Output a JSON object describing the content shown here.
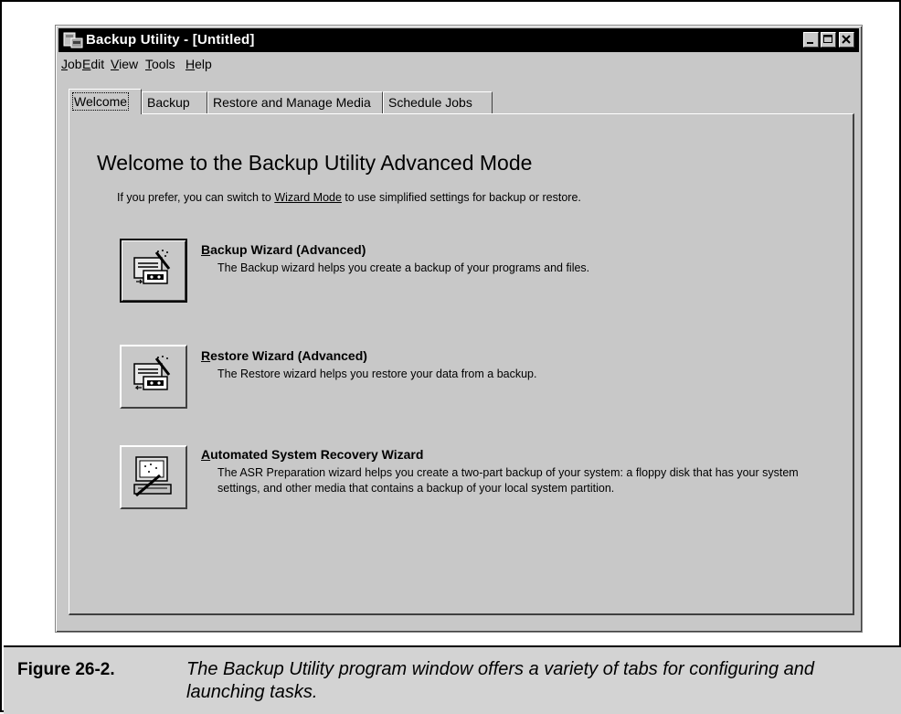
{
  "window": {
    "title": "Backup Utility - [Untitled]",
    "minimize_label": "▁",
    "maximize_label": "□",
    "close_label": "✕"
  },
  "menu": [
    {
      "hotkey": "J",
      "rest": "ob"
    },
    {
      "hotkey": "E",
      "rest": "dit"
    },
    {
      "hotkey": "V",
      "rest": "iew"
    },
    {
      "hotkey": "T",
      "rest": "ools"
    },
    {
      "hotkey": "H",
      "rest": "elp"
    }
  ],
  "tabs": [
    {
      "label": "Welcome",
      "active": true
    },
    {
      "label": "Backup",
      "active": false
    },
    {
      "label": "Restore and Manage Media",
      "active": false
    },
    {
      "label": "Schedule Jobs",
      "active": false
    }
  ],
  "welcome": {
    "heading": "Welcome to the Backup Utility Advanced Mode",
    "intro_before": "If you prefer, you can switch to ",
    "intro_link": "Wizard Mode",
    "intro_after": " to use simplified settings for backup or restore."
  },
  "wizards": [
    {
      "icon": "backup-wizard-icon",
      "hotkey": "B",
      "title_rest": "ackup Wizard (Advanced)",
      "description": "The Backup wizard helps you create a backup of your programs and files."
    },
    {
      "icon": "restore-wizard-icon",
      "hotkey": "R",
      "title_rest": "estore Wizard (Advanced)",
      "description": "The Restore wizard helps you restore your data from a backup."
    },
    {
      "icon": "asr-wizard-icon",
      "hotkey": "A",
      "title_rest": "utomated System Recovery Wizard",
      "description": "The ASR Preparation wizard helps you create a two-part backup of your system: a floppy disk that has your system settings, and other media that contains a backup of your local system partition."
    }
  ],
  "caption": {
    "label": "Figure 26-2.",
    "text": "The Backup Utility program window offers a variety of tabs for configuring and launching tasks."
  },
  "colors": {
    "window_bg": "#c8c8c8",
    "titlebar_bg": "#000000",
    "caption_bg": "#d3d3d3"
  }
}
